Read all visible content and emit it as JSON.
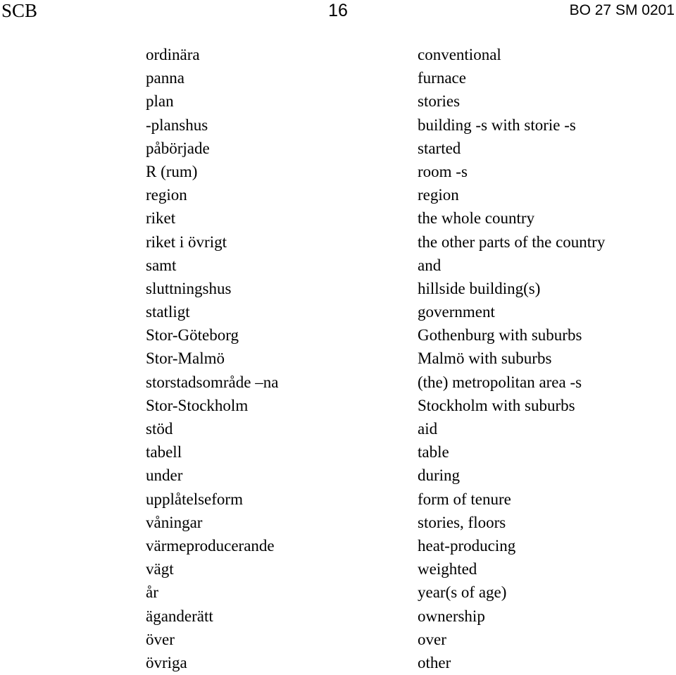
{
  "header": {
    "organization": "SCB",
    "page_number": "16",
    "publication_code": "BO 27 SM 0201"
  },
  "glossary": {
    "rows": [
      {
        "swedish": "ordinära",
        "english": "conventional"
      },
      {
        "swedish": "panna",
        "english": "furnace"
      },
      {
        "swedish": "plan",
        "english": "stories"
      },
      {
        "swedish": "-planshus",
        "english": "building -s with storie -s"
      },
      {
        "swedish": "påbörjade",
        "english": "started"
      },
      {
        "swedish": "R (rum)",
        "english": "room -s"
      },
      {
        "swedish": "region",
        "english": "region"
      },
      {
        "swedish": "riket",
        "english": "the whole country"
      },
      {
        "swedish": "riket i övrigt",
        "english": "the other parts of the country"
      },
      {
        "swedish": "samt",
        "english": "and"
      },
      {
        "swedish": "sluttningshus",
        "english": "hillside building(s)"
      },
      {
        "swedish": "statligt",
        "english": "government"
      },
      {
        "swedish": "Stor-Göteborg",
        "english": "Gothenburg with suburbs"
      },
      {
        "swedish": "Stor-Malmö",
        "english": "Malmö with suburbs"
      },
      {
        "swedish": "storstadsområde –na",
        "english": "(the) metropolitan area -s"
      },
      {
        "swedish": "Stor-Stockholm",
        "english": "Stockholm with suburbs"
      },
      {
        "swedish": "stöd",
        "english": "aid"
      },
      {
        "swedish": "tabell",
        "english": "table"
      },
      {
        "swedish": "under",
        "english": "during"
      },
      {
        "swedish": "upplåtelseform",
        "english": "form of tenure"
      },
      {
        "swedish": "våningar",
        "english": "stories, floors"
      },
      {
        "swedish": "värmeproducerande",
        "english": "heat-producing"
      },
      {
        "swedish": "vägt",
        "english": "weighted"
      },
      {
        "swedish": "år",
        "english": "year(s of age)"
      },
      {
        "swedish": "äganderätt",
        "english": "ownership"
      },
      {
        "swedish": "över",
        "english": "over"
      },
      {
        "swedish": "övriga",
        "english": "other"
      }
    ]
  }
}
